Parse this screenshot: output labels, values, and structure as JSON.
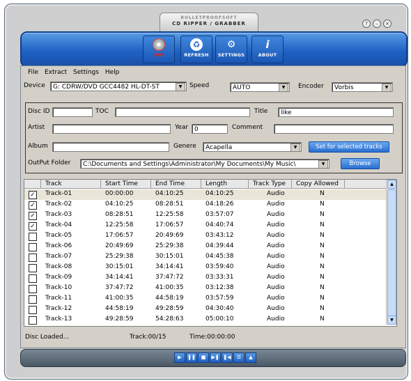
{
  "window": {
    "brand": "BULLETPROOFSOFT",
    "title": "CD RIPPER / GRABBER",
    "help_glyph": "?",
    "minimize_glyph": "–",
    "close_glyph": "×"
  },
  "toolbar": {
    "rip": "RIP",
    "refresh": "REFRESH",
    "settings": "SETTINGS",
    "about": "ABOUT"
  },
  "menu": {
    "file": "File",
    "extract": "Extract",
    "settings": "Settings",
    "help": "Help"
  },
  "device": {
    "label": "Device",
    "value": "G: CDRW/DVD GCC4482 HL-DT-ST",
    "speed_label": "Speed",
    "speed_value": "AUTO",
    "encoder_label": "Encoder",
    "encoder_value": "Vorbis"
  },
  "disc": {
    "discid_label": "Disc ID",
    "discid_value": "",
    "toc_label": "TOC",
    "toc_value": "",
    "title_label": "Title",
    "title_value": "like",
    "artist_label": "Artist",
    "artist_value": "",
    "year_label": "Year",
    "year_value": "0",
    "comment_label": "Comment",
    "comment_value": "",
    "album_label": "Album",
    "album_value": "",
    "genre_label": "Genere",
    "genre_value": "Acapella",
    "set_button": "Set for selected tracks",
    "output_label": "OutPut Folder",
    "output_value": "C:\\Documents and Settings\\Administrator\\My Documents\\My Music\\",
    "browse_button": "Browse"
  },
  "tracklist": {
    "headers": [
      "Track",
      "Start Time",
      "End Time",
      "Length",
      "Track Type",
      "Copy Allowed"
    ],
    "rows": [
      {
        "checked": true,
        "track": "Track-01",
        "start": "00:00:00",
        "end": "04:10:25",
        "length": "04:10:25",
        "type": "Audio",
        "copy": "N"
      },
      {
        "checked": true,
        "track": "Track-02",
        "start": "04:10:25",
        "end": "08:28:51",
        "length": "04:18:26",
        "type": "Audio",
        "copy": "N"
      },
      {
        "checked": true,
        "track": "Track-03",
        "start": "08:28:51",
        "end": "12:25:58",
        "length": "03:57:07",
        "type": "Audio",
        "copy": "N"
      },
      {
        "checked": true,
        "track": "Track-04",
        "start": "12:25:58",
        "end": "17:06:57",
        "length": "04:40:74",
        "type": "Audio",
        "copy": "N"
      },
      {
        "checked": false,
        "track": "Track-05",
        "start": "17:06:57",
        "end": "20:49:69",
        "length": "03:43:12",
        "type": "Audio",
        "copy": "N"
      },
      {
        "checked": false,
        "track": "Track-06",
        "start": "20:49:69",
        "end": "25:29:38",
        "length": "04:39:44",
        "type": "Audio",
        "copy": "N"
      },
      {
        "checked": false,
        "track": "Track-07",
        "start": "25:29:38",
        "end": "30:15:01",
        "length": "04:45:38",
        "type": "Audio",
        "copy": "N"
      },
      {
        "checked": false,
        "track": "Track-08",
        "start": "30:15:01",
        "end": "34:14:41",
        "length": "03:59:40",
        "type": "Audio",
        "copy": "N"
      },
      {
        "checked": false,
        "track": "Track-09",
        "start": "34:14:41",
        "end": "37:47:72",
        "length": "03:33:31",
        "type": "Audio",
        "copy": "N"
      },
      {
        "checked": false,
        "track": "Track-10",
        "start": "37:47:72",
        "end": "41:00:35",
        "length": "03:12:38",
        "type": "Audio",
        "copy": "N"
      },
      {
        "checked": false,
        "track": "Track-11",
        "start": "41:00:35",
        "end": "44:58:19",
        "length": "03:57:59",
        "type": "Audio",
        "copy": "N"
      },
      {
        "checked": false,
        "track": "Track-12",
        "start": "44:58:19",
        "end": "49:28:59",
        "length": "04:30:40",
        "type": "Audio",
        "copy": "N"
      },
      {
        "checked": false,
        "track": "Track-13",
        "start": "49:28:59",
        "end": "54:28:63",
        "length": "05:00:10",
        "type": "Audio",
        "copy": "N"
      }
    ]
  },
  "status": {
    "message": "Disc Loaded...",
    "track": "Track:00/15",
    "time": "Time:00:00:00"
  },
  "player": {
    "play": "▶",
    "pause": "❚❚",
    "stop": "■",
    "next": "▶❚",
    "prev": "❚◀",
    "list": "☰",
    "eject": "▲"
  },
  "icons": {
    "rip": "cd-icon",
    "refresh": "recycle-icon",
    "settings": "gears-icon",
    "about": "info-icon"
  },
  "colors": {
    "toolbar": "#1f62c5",
    "rip_label": "#e02020",
    "button": "#2a6fd0"
  }
}
